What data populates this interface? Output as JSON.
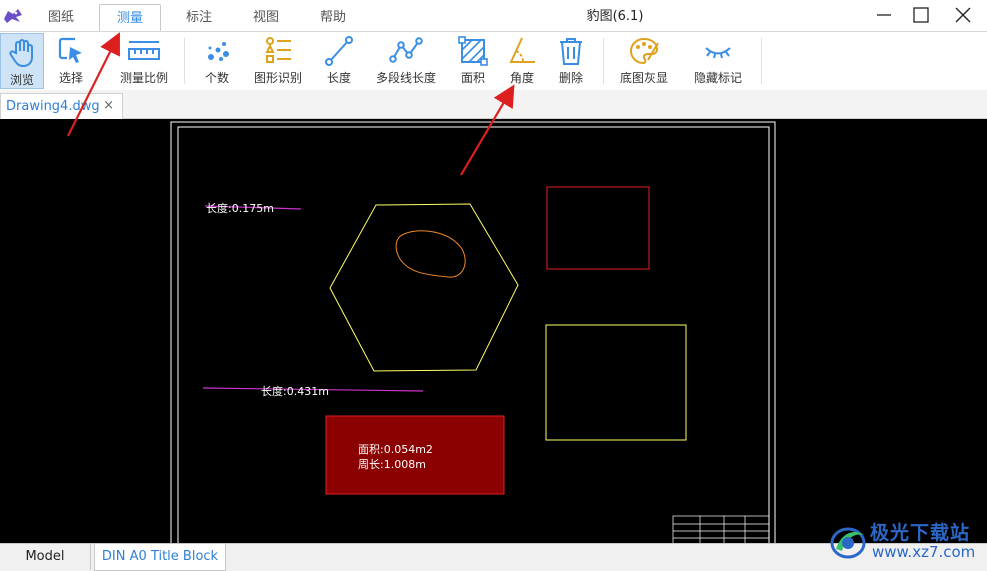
{
  "window": {
    "title": "豹图(6.1)"
  },
  "menu_tabs": [
    {
      "label": "图纸",
      "active": false
    },
    {
      "label": "测量",
      "active": true
    },
    {
      "label": "标注",
      "active": false
    },
    {
      "label": "视图",
      "active": false
    },
    {
      "label": "帮助",
      "active": false
    }
  ],
  "toolbar": {
    "browse": "浏览",
    "select": "选择",
    "measure_scale": "测量比例",
    "count": "个数",
    "shape_recognition": "图形识别",
    "length": "长度",
    "polyline_length": "多段线长度",
    "area": "面积",
    "angle": "角度",
    "delete": "删除",
    "base_gray": "底图灰显",
    "hide_marks": "隐藏标记"
  },
  "document_tab": {
    "name": "Drawing4.dwg",
    "close": "×"
  },
  "drawing": {
    "length_label_1": "长度:0.175m",
    "length_label_2": "长度:0.431m",
    "area_label": "面积:0.054m2",
    "perimeter_label": "周长:1.008m"
  },
  "layout_tabs": {
    "model": "Model",
    "title_block": "DIN A0 Title Block"
  },
  "watermark": {
    "brand": "极光下载站",
    "url": "www.xz7.com"
  },
  "colors": {
    "accent": "#3a8ee6",
    "canvas": "#000000",
    "hexagon": "#ffff66",
    "red_rect": "#e02020",
    "area_fill": "#8b0000",
    "measure_line": "#cc33cc",
    "annotation_arrow": "#dd1f1f"
  }
}
